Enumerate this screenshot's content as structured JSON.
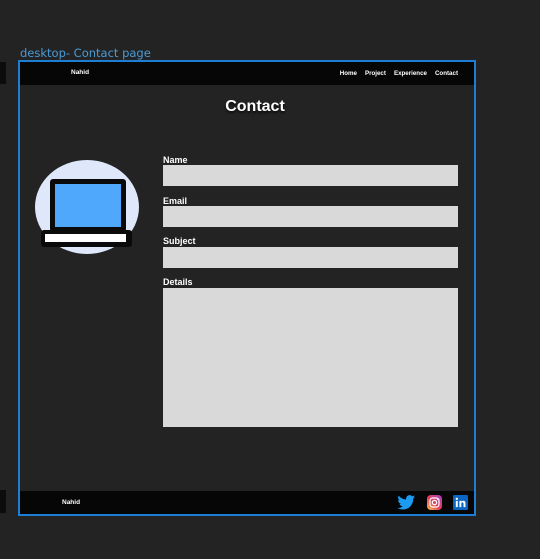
{
  "frame": {
    "label": "desktop- Contact page"
  },
  "nav": {
    "brand": "Nahid",
    "links": [
      "Home",
      "Project",
      "Experience",
      "Contact"
    ]
  },
  "page": {
    "title": "Contact"
  },
  "form": {
    "name_label": "Name",
    "email_label": "Email",
    "subject_label": "Subject",
    "details_label": "Details",
    "name_value": "",
    "email_value": "",
    "subject_value": "",
    "details_value": ""
  },
  "footer": {
    "brand": "Nahid",
    "social": [
      "twitter-icon",
      "instagram-icon",
      "linkedin-icon"
    ]
  },
  "colors": {
    "background": "#232323",
    "bar": "#060606",
    "frame_border": "#1d7fd4",
    "input": "#d9d9d9",
    "avatar_bg": "#dfe8fb",
    "laptop_screen": "#4fa8fb",
    "twitter": "#1d9bf0",
    "linkedin": "#0a66c2"
  }
}
